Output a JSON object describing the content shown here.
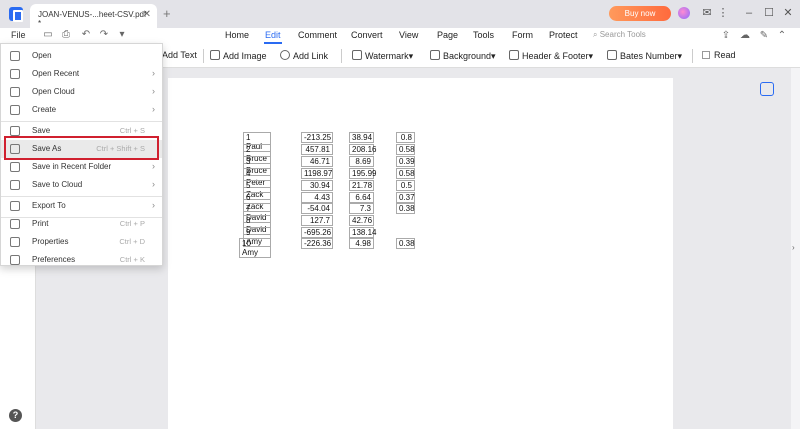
{
  "titlebar": {
    "tab_title": "JOAN-VENUS-...heet-CSV.pdf *",
    "tab_close": "✕",
    "new_tab": "+",
    "buy_now": "Buy now"
  },
  "menubar": {
    "file": "File",
    "items": [
      "Home",
      "Edit",
      "Comment",
      "Convert",
      "View",
      "Page",
      "Tools",
      "Form",
      "Protect"
    ],
    "active": "Edit",
    "search_placeholder": "Search Tools"
  },
  "toolbar": {
    "add_text": "Add Text",
    "add_image": "Add Image",
    "add_link": "Add Link",
    "watermark": "Watermark",
    "background": "Background",
    "header_footer": "Header & Footer",
    "bates_number": "Bates Number",
    "read": "Read"
  },
  "file_menu": {
    "items": [
      {
        "label": "Open",
        "shortcut": "",
        "arrow": ""
      },
      {
        "label": "Open Recent",
        "shortcut": "",
        "arrow": "›"
      },
      {
        "label": "Open Cloud",
        "shortcut": "",
        "arrow": "›"
      },
      {
        "label": "Create",
        "shortcut": "",
        "arrow": "›"
      },
      {
        "label": "Save",
        "shortcut": "Ctrl + S",
        "arrow": ""
      },
      {
        "label": "Save As",
        "shortcut": "Ctrl + Shift + S",
        "arrow": ""
      },
      {
        "label": "Save in Recent Folder",
        "shortcut": "",
        "arrow": "›"
      },
      {
        "label": "Save to Cloud",
        "shortcut": "",
        "arrow": "›"
      },
      {
        "label": "Export To",
        "shortcut": "",
        "arrow": "›"
      },
      {
        "label": "Print",
        "shortcut": "Ctrl + P",
        "arrow": ""
      },
      {
        "label": "Properties",
        "shortcut": "Ctrl + D",
        "arrow": ""
      },
      {
        "label": "Preferences",
        "shortcut": "Ctrl + K",
        "arrow": ""
      }
    ]
  },
  "table": {
    "rows": [
      {
        "idx": "1",
        "name": "Paul",
        "a": "-213.25",
        "b": "38.94",
        "c": "0.8"
      },
      {
        "idx": "2",
        "name": "Bruce",
        "a": "457.81",
        "b": "208.16",
        "c": "0.58"
      },
      {
        "idx": "3",
        "name": "Bruce",
        "a": "46.71",
        "b": "8.69",
        "c": "0.39"
      },
      {
        "idx": "4",
        "name": "Peter",
        "a": "1198.97",
        "b": "195.99",
        "c": "0.58"
      },
      {
        "idx": "5",
        "name": "Zack",
        "a": "30.94",
        "b": "21.78",
        "c": "0.5"
      },
      {
        "idx": "6",
        "name": "Zack",
        "a": "4.43",
        "b": "6.64",
        "c": "0.37"
      },
      {
        "idx": "7",
        "name": "David",
        "a": "-54.04",
        "b": "7.3",
        "c": "0.38"
      },
      {
        "idx": "8",
        "name": "David",
        "a": "127.7",
        "b": "42.76",
        "c": ""
      },
      {
        "idx": "9",
        "name": "Amy",
        "a": "-695.26",
        "b": "138.14",
        "c": ""
      },
      {
        "idx": "10",
        "name": "Amy",
        "a": "-226.36",
        "b": "4.98",
        "c": "0.38"
      }
    ]
  },
  "help_icon": "?"
}
